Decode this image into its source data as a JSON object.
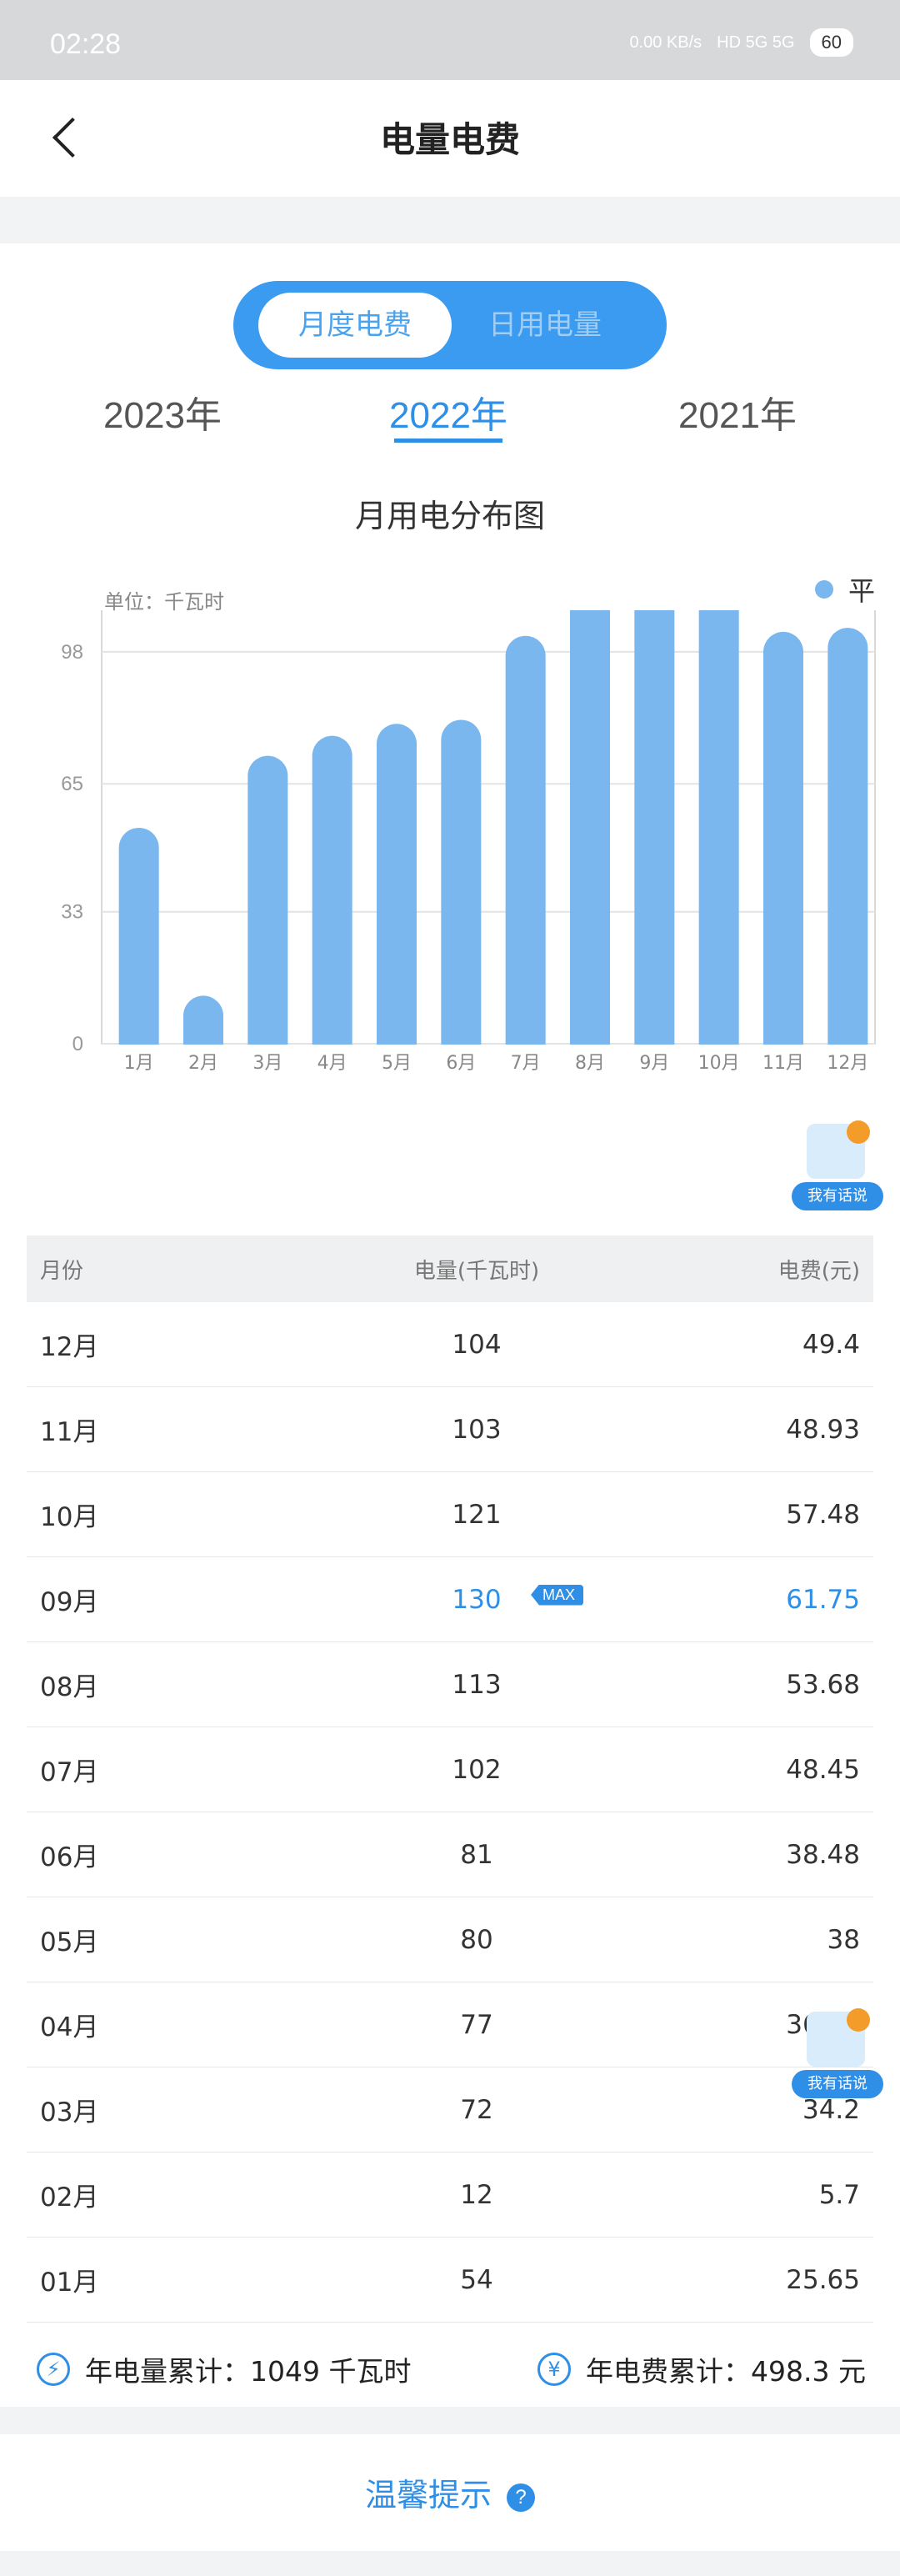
{
  "status_bar": {
    "time": "02:28",
    "net_speed": "0.00 KB/s",
    "indicators": "HD  5G  5G",
    "battery": "60"
  },
  "header": {
    "title": "电量电费"
  },
  "toggle": {
    "active": "月度电费",
    "inactive": "日用电量"
  },
  "years": [
    "2023年",
    "2022年",
    "2021年"
  ],
  "selected_year": "2022年",
  "chart_data": {
    "type": "bar",
    "title": "月用电分布图",
    "unit": "单位：千瓦时",
    "legend": [
      "平"
    ],
    "legend_position": "top-right",
    "categories": [
      "1月",
      "2月",
      "3月",
      "4月",
      "5月",
      "6月",
      "7月",
      "8月",
      "9月",
      "10月",
      "11月",
      "12月"
    ],
    "series": [
      {
        "name": "平",
        "values": [
          54,
          12,
          72,
          77,
          80,
          81,
          102,
          113,
          130,
          121,
          103,
          104
        ]
      }
    ],
    "yticks": [
      "0",
      "33",
      "65",
      "98",
      "133"
    ],
    "ylim": [
      0,
      133
    ],
    "grid": true,
    "color": "#7ab7ef"
  },
  "float_button": {
    "label": "我有话说"
  },
  "table": {
    "headers": [
      "月份",
      "电量(千瓦时)",
      "电费(元)"
    ],
    "rows": [
      [
        "12月",
        "104",
        "49.4"
      ],
      [
        "11月",
        "103",
        "48.93"
      ],
      [
        "10月",
        "121",
        "57.48"
      ],
      [
        "09月",
        "130",
        "61.75"
      ],
      [
        "08月",
        "113",
        "53.68"
      ],
      [
        "07月",
        "102",
        "48.45"
      ],
      [
        "06月",
        "81",
        "38.48"
      ],
      [
        "05月",
        "80",
        "38"
      ],
      [
        "04月",
        "77",
        "36.58"
      ],
      [
        "03月",
        "72",
        "34.2"
      ],
      [
        "02月",
        "12",
        "5.7"
      ],
      [
        "01月",
        "54",
        "25.65"
      ]
    ],
    "max_badge": "MAX"
  },
  "summary": {
    "annual_energy": "年电量累计：1049 千瓦时",
    "annual_fee": "年电费累计：498.3 元",
    "energy_icon": "⚡",
    "fee_icon": "¥"
  },
  "tip": {
    "label": "温馨提示",
    "icon": "?"
  }
}
